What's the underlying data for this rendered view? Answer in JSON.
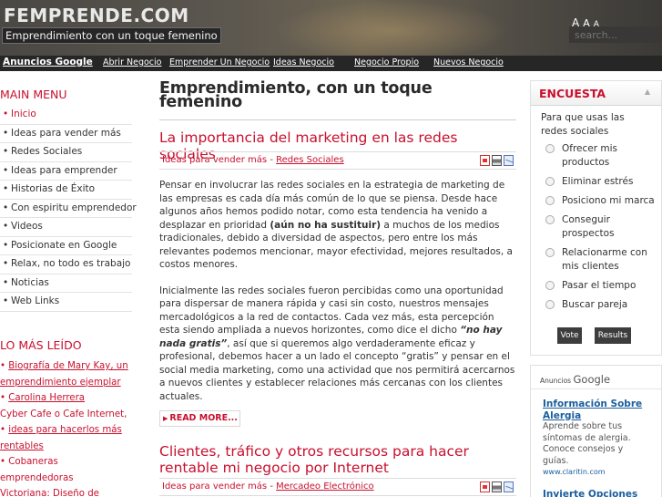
{
  "header": {
    "site_title": "FEMPRENDE.COM",
    "tagline": "Emprendimiento con un toque femenino",
    "font_sizer": {
      "big": "A",
      "mid": "A",
      "small": "A"
    },
    "search_placeholder": "search..."
  },
  "navbar": {
    "brand": "Anuncios Google",
    "links": [
      "Abrir Negocio",
      "Emprender Un Negocio",
      "Ideas Negocio",
      "Negocio Propio",
      "Nuevos Negocio"
    ]
  },
  "sidebar": {
    "menu_title": "MAIN MENU",
    "menu_items": [
      "Inicio",
      "Ideas para vender más",
      "Redes Sociales",
      "Ideas para emprender",
      "Historias de Éxito",
      "Con espiritu emprendedor",
      "Videos",
      "Posicionate en Google",
      "Relax, no todo es trabajo",
      "Noticias",
      "Web Links"
    ],
    "most_read_title": "LO MÁS LEÍDO",
    "most_read": [
      "Biografía de Mary Kay, un",
      "emprendimiento ejemplar",
      "Carolina Herrera",
      "Cyber Cafe o Cafe Internet,",
      "ideas para hacerlos más",
      "rentables",
      "Cobaneras",
      "emprendedoras",
      "Victoriana: Diseño de"
    ]
  },
  "main": {
    "page_title": "Emprendimiento, con un toque femenino",
    "post1": {
      "title": "La importancia del marketing en las redes sociales",
      "category1": "Ideas para vender más",
      "separator": " - ",
      "category2": "Redes Sociales",
      "p1_a": "Pensar en involucrar las redes sociales en la estrategia de marketing de las empresas es cada día más común de lo que se piensa.  Desde hace algunos años hemos podido notar, como esta tendencia ha venido a desplazar en prioridad ",
      "p1_b": "(aún no ha sustituir)",
      "p1_c": " a muchos de los medios tradicionales, debido a diversidad de aspectos, pero entre los más relevantes podemos mencionar, mayor efectividad, mejores resultados, a costos menores.",
      "p2_a": "Inicialmente las redes sociales fueron percibidas como una oportunidad para dispersar de manera rápida y casi sin costo, nuestros mensajes mercadológicos a la red de contactos.  Cada vez más, esta percepción esta siendo ampliada a nuevos horizontes, como dice el dicho ",
      "p2_b": "“no hay nada gratis”",
      "p2_c": ", así que si queremos algo verdaderamente eficaz y profesional, debemos hacer a un lado el concepto “gratis” y pensar en el social media marketing, como una actividad que nos permitirá acercarnos a nuevos clientes y establecer relaciones más cercanas con los clientes actuales.",
      "read_more": "READ MORE..."
    },
    "post2": {
      "title": "Clientes, tráfico y otros recursos para hacer rentable mi negocio por Internet",
      "category1": "Ideas para vender más",
      "separator": " - ",
      "category2": "Mercadeo Electrónico"
    }
  },
  "poll": {
    "title": "ENCUESTA",
    "question": "Para que usas las redes sociales",
    "options": [
      "Ofrecer mis productos",
      "Eliminar estrés",
      "Posiciono mi marca",
      "Conseguir prospectos",
      "Relacionarme con mis clientes",
      "Pasar el tiempo",
      "Buscar pareja"
    ],
    "vote_label": "Vote",
    "results_label": "Results"
  },
  "ads": {
    "label_small": "Anuncios",
    "label_big": "Google",
    "ad1": {
      "title": "Información Sobre Alergia",
      "text": "Aprende sobre tus síntomas de alergia. Conoce consejos y guías.",
      "url": "www.claritin.com"
    },
    "ad2": {
      "title": "Invierte Opciones"
    }
  }
}
